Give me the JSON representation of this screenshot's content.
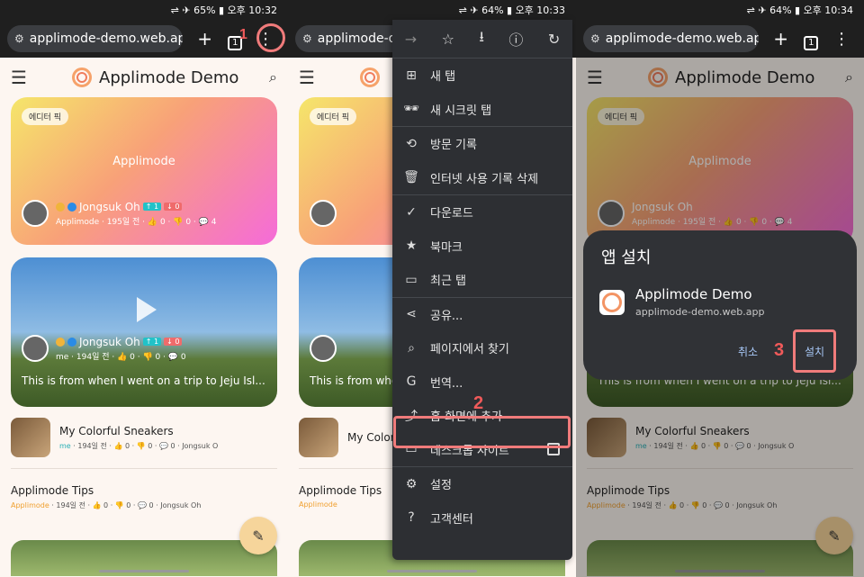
{
  "panels": [
    {
      "status": "⇌ ✈ 65% ▮ 오후 10:32",
      "url": "applimode-demo.web.app",
      "tab_count": "1"
    },
    {
      "status": "⇌ ✈ 64% ▮ 오후 10:33",
      "url": "applimode-de",
      "tab_count": "1"
    },
    {
      "status": "⇌ ✈ 64% ▮ 오후 10:34",
      "url": "applimode-demo.web.app",
      "tab_count": "1"
    }
  ],
  "app": {
    "title": "Applimode Demo",
    "editor_pick": "에디터 픽",
    "card1_text": "Applimode",
    "author1": "Jongsuk Oh",
    "author1_up": "↑ 1",
    "author1_down": "↓ 0",
    "author1_stats": "Applimode · 195일 전 · 👍 0 · 👎 0 · 💬 4",
    "author2": "Jongsuk Oh",
    "author2_up": "↑ 1",
    "author2_down": "↓ 0",
    "author2_stats": "me · 194일 전 · 👍 0 · 👎 0 · 💬 0",
    "video_caption": "This is from when I went on a trip to Jeju Isl...",
    "item1_title": "My Colorful Sneakers",
    "item1_meta_src": "me",
    "item1_meta": " · 194일 전 · 👍 0 · 👎 0 · 💬 0 · ",
    "item1_author": "Jongsuk O",
    "item2_title": "Applimode Tips",
    "item2_meta_src": "Applimode",
    "item2_meta": " · 194일 전 · 👍 0 · 👎 0 · 💬 0 · ",
    "item2_author": "Jongsuk Oh"
  },
  "menu": {
    "top_icons": [
      "→",
      "☆",
      "⭳",
      "ⓘ",
      "↻"
    ],
    "items": [
      {
        "icon": "⊞",
        "label": "새 탭"
      },
      {
        "icon": "🕶",
        "label": "새 시크릿 탭"
      },
      {
        "icon": "⟲",
        "label": "방문 기록"
      },
      {
        "icon": "🗑",
        "label": "인터넷 사용 기록 삭제"
      },
      {
        "icon": "✓",
        "label": "다운로드"
      },
      {
        "icon": "★",
        "label": "북마크"
      },
      {
        "icon": "▭",
        "label": "최근 탭"
      },
      {
        "icon": "⋖",
        "label": "공유..."
      },
      {
        "icon": "⌕",
        "label": "페이지에서 찾기"
      },
      {
        "icon": "G",
        "label": "번역..."
      },
      {
        "icon": "⤴",
        "label": "홈 화면에 추가"
      },
      {
        "icon": "▭",
        "label": "데스크톱 사이트"
      },
      {
        "icon": "⚙",
        "label": "설정"
      },
      {
        "icon": "?",
        "label": "고객센터"
      }
    ]
  },
  "dialog": {
    "title": "앱 설치",
    "app_name": "Applimode Demo",
    "app_url": "applimode-demo.web.app",
    "cancel": "취소",
    "install": "설치"
  },
  "steps": [
    "1",
    "2",
    "3"
  ],
  "colors": {
    "highlight": "#f07b7b",
    "step_number": "#f05a5a",
    "accent": "#f6a26a"
  }
}
